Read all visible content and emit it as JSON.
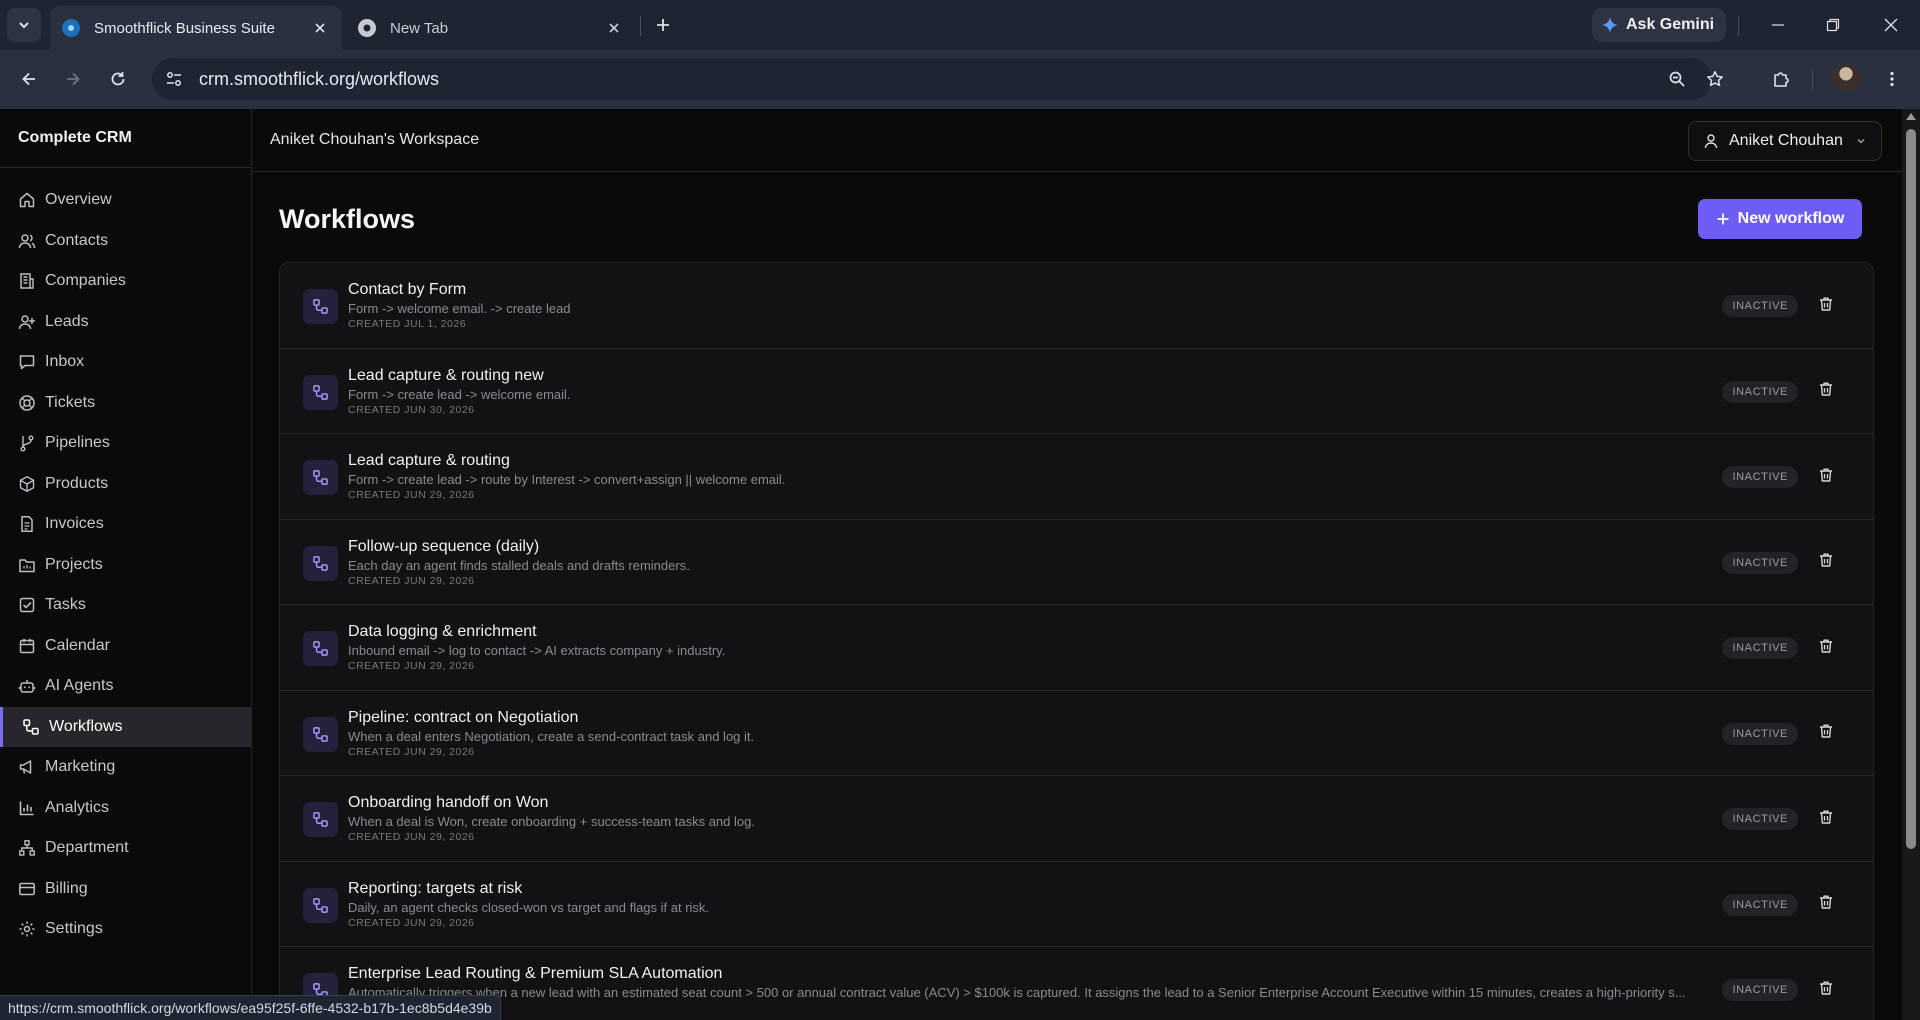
{
  "browser": {
    "tabs": [
      {
        "title": "Smoothflick Business Suite",
        "active": true
      },
      {
        "title": "New Tab",
        "active": false
      }
    ],
    "gemini_label": "Ask Gemini",
    "url": "crm.smoothflick.org/workflows",
    "status_url": "https://crm.smoothflick.org/workflows/ea95f25f-6ffe-4532-b17b-1ec8b5d4e39b"
  },
  "app": {
    "brand": "Complete CRM",
    "workspace": "Aniket Chouhan's Workspace",
    "user_name": "Aniket Chouhan",
    "accent_color": "#6d5cf6"
  },
  "sidebar": {
    "items": [
      {
        "label": "Overview",
        "icon": "home-icon"
      },
      {
        "label": "Contacts",
        "icon": "users-icon"
      },
      {
        "label": "Companies",
        "icon": "building-icon"
      },
      {
        "label": "Leads",
        "icon": "user-plus-icon"
      },
      {
        "label": "Inbox",
        "icon": "message-icon"
      },
      {
        "label": "Tickets",
        "icon": "lifebuoy-icon"
      },
      {
        "label": "Pipelines",
        "icon": "branch-icon"
      },
      {
        "label": "Products",
        "icon": "package-icon"
      },
      {
        "label": "Invoices",
        "icon": "file-text-icon"
      },
      {
        "label": "Projects",
        "icon": "folder-icon"
      },
      {
        "label": "Tasks",
        "icon": "checkbox-icon"
      },
      {
        "label": "Calendar",
        "icon": "calendar-icon"
      },
      {
        "label": "AI Agents",
        "icon": "bot-icon"
      },
      {
        "label": "Workflows",
        "icon": "workflow-icon",
        "active": true
      },
      {
        "label": "Marketing",
        "icon": "megaphone-icon"
      },
      {
        "label": "Analytics",
        "icon": "bar-chart-icon"
      },
      {
        "label": "Department",
        "icon": "network-icon"
      },
      {
        "label": "Billing",
        "icon": "credit-card-icon"
      },
      {
        "label": "Settings",
        "icon": "gear-icon"
      }
    ]
  },
  "page": {
    "title": "Workflows",
    "new_button_label": "New workflow"
  },
  "workflows": [
    {
      "name": "Contact by Form",
      "description": "Form -> welcome email. -> create lead",
      "created": "CREATED JUL 1, 2026",
      "status": "INACTIVE"
    },
    {
      "name": "Lead capture & routing new",
      "description": "Form -> create lead -> welcome email.",
      "created": "CREATED JUN 30, 2026",
      "status": "INACTIVE"
    },
    {
      "name": "Lead capture & routing",
      "description": "Form -> create lead -> route by Interest -> convert+assign || welcome email.",
      "created": "CREATED JUN 29, 2026",
      "status": "INACTIVE"
    },
    {
      "name": "Follow-up sequence (daily)",
      "description": "Each day an agent finds stalled deals and drafts reminders.",
      "created": "CREATED JUN 29, 2026",
      "status": "INACTIVE"
    },
    {
      "name": "Data logging & enrichment",
      "description": "Inbound email -> log to contact -> AI extracts company + industry.",
      "created": "CREATED JUN 29, 2026",
      "status": "INACTIVE"
    },
    {
      "name": "Pipeline: contract on Negotiation",
      "description": "When a deal enters Negotiation, create a send-contract task and log it.",
      "created": "CREATED JUN 29, 2026",
      "status": "INACTIVE"
    },
    {
      "name": "Onboarding handoff on Won",
      "description": "When a deal is Won, create onboarding + success-team tasks and log.",
      "created": "CREATED JUN 29, 2026",
      "status": "INACTIVE"
    },
    {
      "name": "Reporting: targets at risk",
      "description": "Daily, an agent checks closed-won vs target and flags if at risk.",
      "created": "CREATED JUN 29, 2026",
      "status": "INACTIVE"
    },
    {
      "name": "Enterprise Lead Routing & Premium SLA Automation",
      "description": "Automatically triggers when a new lead with an estimated seat count > 500 or annual contract value (ACV) > $100k is captured. It assigns the lead to a Senior Enterprise Account Executive within 15 minutes, creates a high-priority s...",
      "created": "",
      "status": "INACTIVE"
    }
  ]
}
